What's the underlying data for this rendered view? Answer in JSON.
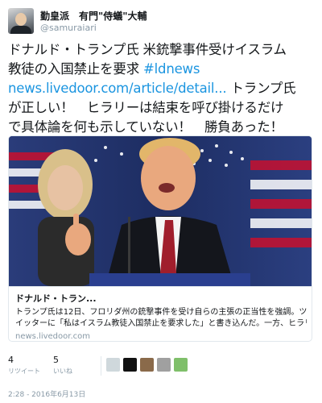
{
  "user": {
    "display_name": "勤皇派　有門\"侍蟻\"大輔",
    "handle": "@samuraiari"
  },
  "tweet": {
    "line1": "ドナルド・トランプ氏 米銃撃事件受けイスラム",
    "line2_text": "教徒の入国禁止を要求 ",
    "line2_hashtag": "#ldnews",
    "line3_link": "news.livedoor.com/article/detail...",
    "line3_text": " トランプ氏",
    "line4": "が正しい！　ヒラリーは結束を呼び掛けるだけ",
    "line5": "で具体論を何も示していない！　勝負あった！"
  },
  "card": {
    "title": "ドナルド・トラン...",
    "desc_line1": "トランプ氏は12日、フロリダ州の銃撃事件を受け自らの主張の正当性を強調。ツ",
    "desc_line2": "イッターに「私はイスラム教徒入国禁止を要求した」と書き込んだ。一方、ヒラリ",
    "domain": "news.livedoor.com"
  },
  "stats": {
    "retweets": "4",
    "retweets_label": "リツイート",
    "likes": "5",
    "likes_label": "いいね"
  },
  "likers": {
    "colors": [
      "#cfd8dc",
      "#111111",
      "#8a6a4a",
      "#a0a0a0",
      "#7fbf6a"
    ]
  },
  "timestamp": "2:28 - 2016年6月13日"
}
